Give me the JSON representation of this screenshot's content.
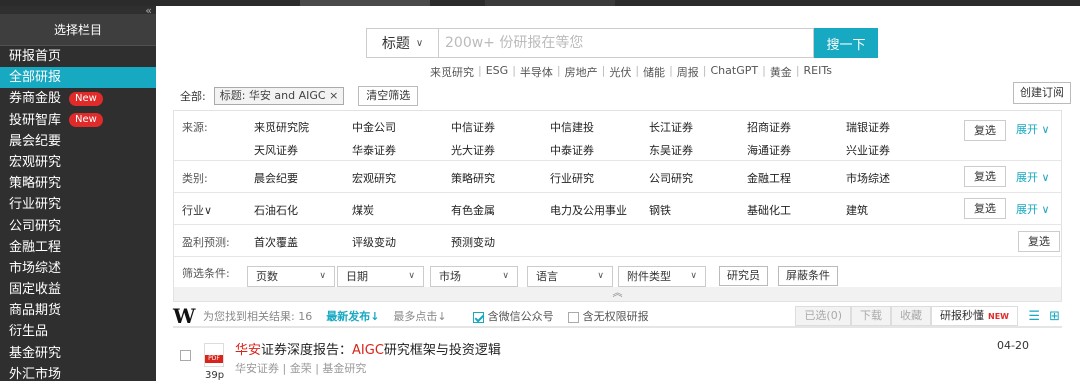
{
  "sidebar": {
    "header": "选择栏目",
    "collapse_glyph": "«",
    "items": [
      {
        "label": "研报首页",
        "active": false,
        "badge": ""
      },
      {
        "label": "全部研报",
        "active": true,
        "badge": ""
      },
      {
        "label": "券商金股",
        "active": false,
        "badge": "New"
      },
      {
        "label": "投研智库",
        "active": false,
        "badge": "New"
      },
      {
        "label": "晨会纪要",
        "active": false,
        "badge": ""
      },
      {
        "label": "宏观研究",
        "active": false,
        "badge": ""
      },
      {
        "label": "策略研究",
        "active": false,
        "badge": ""
      },
      {
        "label": "行业研究",
        "active": false,
        "badge": ""
      },
      {
        "label": "公司研究",
        "active": false,
        "badge": ""
      },
      {
        "label": "金融工程",
        "active": false,
        "badge": ""
      },
      {
        "label": "市场综述",
        "active": false,
        "badge": ""
      },
      {
        "label": "固定收益",
        "active": false,
        "badge": ""
      },
      {
        "label": "商品期货",
        "active": false,
        "badge": ""
      },
      {
        "label": "衍生品",
        "active": false,
        "badge": ""
      },
      {
        "label": "基金研究",
        "active": false,
        "badge": ""
      },
      {
        "label": "外汇市场",
        "active": false,
        "badge": ""
      }
    ]
  },
  "search": {
    "scope": "标题",
    "placeholder": "200w+ 份研报在等您",
    "button": "搜一下",
    "hot": [
      "来觅研究",
      "ESG",
      "半导体",
      "房地产",
      "光伏",
      "储能",
      "周报",
      "ChatGPT",
      "黄金",
      "REITs"
    ]
  },
  "filters": {
    "all_label": "全部:",
    "active_tag": "标题: 华安 and AIGC ×",
    "clear": "清空筛选",
    "subscribe": "创建订阅",
    "source_label": "来源:",
    "sources_row1": [
      "来觅研究院",
      "中金公司",
      "中信证券",
      "中信建投",
      "长江证券",
      "招商证券",
      "瑞银证券"
    ],
    "sources_row2": [
      "天风证券",
      "华泰证券",
      "光大证券",
      "中泰证券",
      "东吴证券",
      "海通证券",
      "兴业证券"
    ],
    "category_label": "类别:",
    "categories": [
      "晨会纪要",
      "宏观研究",
      "策略研究",
      "行业研究",
      "公司研究",
      "金融工程",
      "市场综述"
    ],
    "industry_label": "行业∨",
    "industries": [
      "石油石化",
      "煤炭",
      "有色金属",
      "电力及公用事业",
      "钢铁",
      "基础化工",
      "建筑"
    ],
    "forecast_label": "盈利预测:",
    "forecasts": [
      "首次覆盖",
      "评级变动",
      "预测变动"
    ],
    "multi_select": "复选",
    "expand": "展开 ∨",
    "cond_label": "筛选条件:",
    "dropdowns": [
      "页数",
      "日期",
      "市场",
      "语言",
      "附件类型"
    ],
    "researcher": "研究员",
    "block": "屏蔽条件",
    "collapse_glyph": "︽"
  },
  "results": {
    "logo": "W",
    "summary": "为您找到相关结果: 16",
    "sort_latest": "最新发布↓",
    "sort_clicks": "最多点击↓",
    "wechat": "含微信公众号",
    "no_permission": "含无权限研报",
    "selected": "已选(0)",
    "download": "下载",
    "favorite": "收藏",
    "read": "研报秒懂",
    "read_badge": "NEW"
  },
  "report": {
    "title_prefix": "华安",
    "title_mid1": "证券深度报告：",
    "title_hl": "AIGC",
    "title_rest": "研究框架与投资逻辑",
    "meta": "华安证券 | 金荣 | 基金研究",
    "date": "04-20",
    "pages": "39p",
    "file_type": "PDF"
  }
}
